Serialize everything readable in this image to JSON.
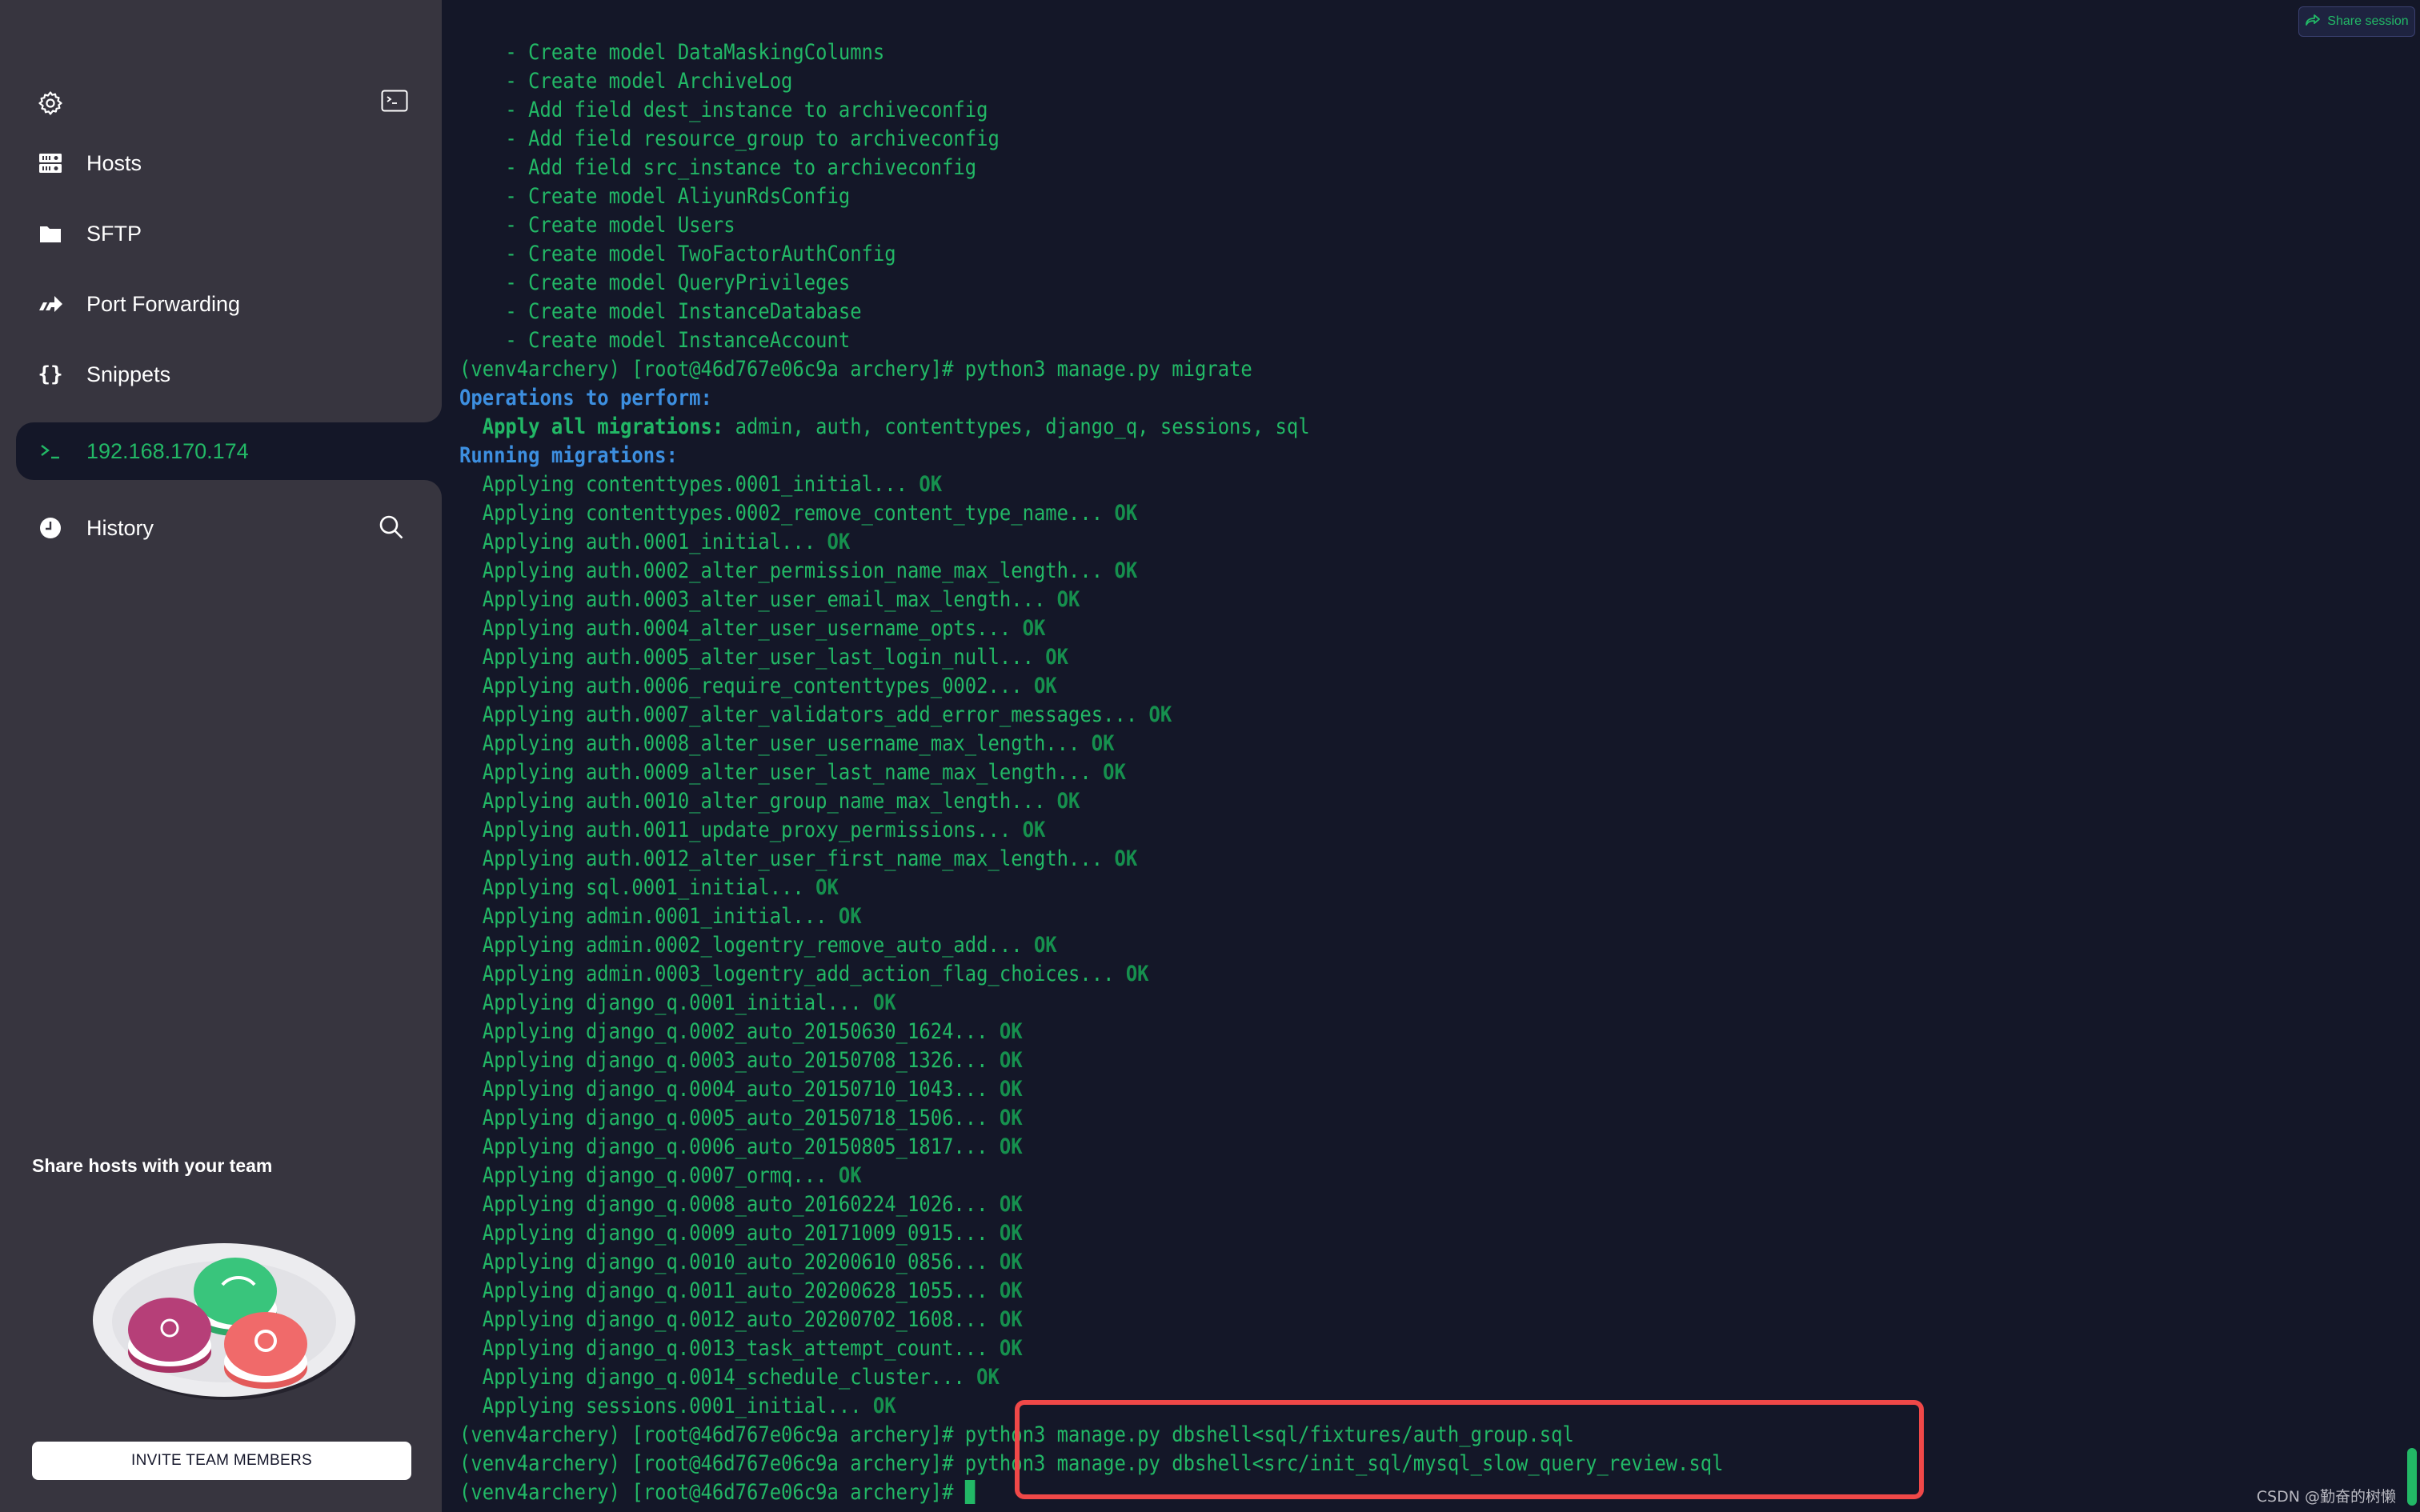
{
  "sidebar": {
    "top_icons": {
      "settings": "gear-icon",
      "terminal": "terminal-icon"
    },
    "items": [
      {
        "label": "Hosts",
        "icon": "server-icon"
      },
      {
        "label": "SFTP",
        "icon": "folder-icon"
      },
      {
        "label": "Port Forwarding",
        "icon": "port-forward-icon"
      },
      {
        "label": "Snippets",
        "icon": "braces-icon"
      },
      {
        "label": "192.168.170.174",
        "icon": "terminal-prompt-icon",
        "active": true
      },
      {
        "label": "History",
        "icon": "clock-icon"
      }
    ],
    "promo": {
      "title": "Share hosts with your team",
      "button": "INVITE TEAM MEMBERS"
    }
  },
  "terminal": {
    "share_button": "Share session",
    "colors": {
      "text": "#22b866",
      "heading": "#3d8fe0",
      "ok": "#16904e",
      "highlight": "#f04848"
    },
    "lines": [
      [
        {
          "t": "    - Create model DataMaskingColumns"
        }
      ],
      [
        {
          "t": "    - Create model ArchiveLog"
        }
      ],
      [
        {
          "t": "    - Add field dest_instance to archiveconfig"
        }
      ],
      [
        {
          "t": "    - Add field resource_group to archiveconfig"
        }
      ],
      [
        {
          "t": "    - Add field src_instance to archiveconfig"
        }
      ],
      [
        {
          "t": "    - Create model AliyunRdsConfig"
        }
      ],
      [
        {
          "t": "    - Create model Users"
        }
      ],
      [
        {
          "t": "    - Create model TwoFactorAuthConfig"
        }
      ],
      [
        {
          "t": "    - Create model QueryPrivileges"
        }
      ],
      [
        {
          "t": "    - Create model InstanceDatabase"
        }
      ],
      [
        {
          "t": "    - Create model InstanceAccount"
        }
      ],
      [
        {
          "t": "(venv4archery) [root@46d767e06c9a archery]# python3 manage.py migrate"
        }
      ],
      [
        {
          "t": "Operations to perform:",
          "s": "blue"
        }
      ],
      [
        {
          "t": "  Apply all migrations:",
          "s": "bold"
        },
        {
          "t": " admin, auth, contenttypes, django_q, sessions, sql"
        }
      ],
      [
        {
          "t": "Running migrations:",
          "s": "blue"
        }
      ],
      [
        {
          "t": "  Applying contenttypes.0001_initial... "
        },
        {
          "t": "OK",
          "s": "ok"
        }
      ],
      [
        {
          "t": "  Applying contenttypes.0002_remove_content_type_name... "
        },
        {
          "t": "OK",
          "s": "ok"
        }
      ],
      [
        {
          "t": "  Applying auth.0001_initial... "
        },
        {
          "t": "OK",
          "s": "ok"
        }
      ],
      [
        {
          "t": "  Applying auth.0002_alter_permission_name_max_length... "
        },
        {
          "t": "OK",
          "s": "ok"
        }
      ],
      [
        {
          "t": "  Applying auth.0003_alter_user_email_max_length... "
        },
        {
          "t": "OK",
          "s": "ok"
        }
      ],
      [
        {
          "t": "  Applying auth.0004_alter_user_username_opts... "
        },
        {
          "t": "OK",
          "s": "ok"
        }
      ],
      [
        {
          "t": "  Applying auth.0005_alter_user_last_login_null... "
        },
        {
          "t": "OK",
          "s": "ok"
        }
      ],
      [
        {
          "t": "  Applying auth.0006_require_contenttypes_0002... "
        },
        {
          "t": "OK",
          "s": "ok"
        }
      ],
      [
        {
          "t": "  Applying auth.0007_alter_validators_add_error_messages... "
        },
        {
          "t": "OK",
          "s": "ok"
        }
      ],
      [
        {
          "t": "  Applying auth.0008_alter_user_username_max_length... "
        },
        {
          "t": "OK",
          "s": "ok"
        }
      ],
      [
        {
          "t": "  Applying auth.0009_alter_user_last_name_max_length... "
        },
        {
          "t": "OK",
          "s": "ok"
        }
      ],
      [
        {
          "t": "  Applying auth.0010_alter_group_name_max_length... "
        },
        {
          "t": "OK",
          "s": "ok"
        }
      ],
      [
        {
          "t": "  Applying auth.0011_update_proxy_permissions... "
        },
        {
          "t": "OK",
          "s": "ok"
        }
      ],
      [
        {
          "t": "  Applying auth.0012_alter_user_first_name_max_length... "
        },
        {
          "t": "OK",
          "s": "ok"
        }
      ],
      [
        {
          "t": "  Applying sql.0001_initial... "
        },
        {
          "t": "OK",
          "s": "ok"
        }
      ],
      [
        {
          "t": "  Applying admin.0001_initial... "
        },
        {
          "t": "OK",
          "s": "ok"
        }
      ],
      [
        {
          "t": "  Applying admin.0002_logentry_remove_auto_add... "
        },
        {
          "t": "OK",
          "s": "ok"
        }
      ],
      [
        {
          "t": "  Applying admin.0003_logentry_add_action_flag_choices... "
        },
        {
          "t": "OK",
          "s": "ok"
        }
      ],
      [
        {
          "t": "  Applying django_q.0001_initial... "
        },
        {
          "t": "OK",
          "s": "ok"
        }
      ],
      [
        {
          "t": "  Applying django_q.0002_auto_20150630_1624... "
        },
        {
          "t": "OK",
          "s": "ok"
        }
      ],
      [
        {
          "t": "  Applying django_q.0003_auto_20150708_1326... "
        },
        {
          "t": "OK",
          "s": "ok"
        }
      ],
      [
        {
          "t": "  Applying django_q.0004_auto_20150710_1043... "
        },
        {
          "t": "OK",
          "s": "ok"
        }
      ],
      [
        {
          "t": "  Applying django_q.0005_auto_20150718_1506... "
        },
        {
          "t": "OK",
          "s": "ok"
        }
      ],
      [
        {
          "t": "  Applying django_q.0006_auto_20150805_1817... "
        },
        {
          "t": "OK",
          "s": "ok"
        }
      ],
      [
        {
          "t": "  Applying django_q.0007_ormq... "
        },
        {
          "t": "OK",
          "s": "ok"
        }
      ],
      [
        {
          "t": "  Applying django_q.0008_auto_20160224_1026... "
        },
        {
          "t": "OK",
          "s": "ok"
        }
      ],
      [
        {
          "t": "  Applying django_q.0009_auto_20171009_0915... "
        },
        {
          "t": "OK",
          "s": "ok"
        }
      ],
      [
        {
          "t": "  Applying django_q.0010_auto_20200610_0856... "
        },
        {
          "t": "OK",
          "s": "ok"
        }
      ],
      [
        {
          "t": "  Applying django_q.0011_auto_20200628_1055... "
        },
        {
          "t": "OK",
          "s": "ok"
        }
      ],
      [
        {
          "t": "  Applying django_q.0012_auto_20200702_1608... "
        },
        {
          "t": "OK",
          "s": "ok"
        }
      ],
      [
        {
          "t": "  Applying django_q.0013_task_attempt_count... "
        },
        {
          "t": "OK",
          "s": "ok"
        }
      ],
      [
        {
          "t": "  Applying django_q.0014_schedule_cluster... "
        },
        {
          "t": "OK",
          "s": "ok"
        }
      ],
      [
        {
          "t": "  Applying sessions.0001_initial... "
        },
        {
          "t": "OK",
          "s": "ok"
        }
      ],
      [
        {
          "t": "(venv4archery) [root@46d767e06c9a archery]# python3 manage.py dbshell<sql/fixtures/auth_group.sql"
        }
      ],
      [
        {
          "t": "(venv4archery) [root@46d767e06c9a archery]# python3 manage.py dbshell<src/init_sql/mysql_slow_query_review.sql"
        }
      ],
      [
        {
          "t": "(venv4archery) [root@46d767e06c9a archery]# "
        },
        {
          "t": "",
          "s": "cursor"
        }
      ]
    ]
  },
  "watermark": "CSDN @勤奋的树懒"
}
